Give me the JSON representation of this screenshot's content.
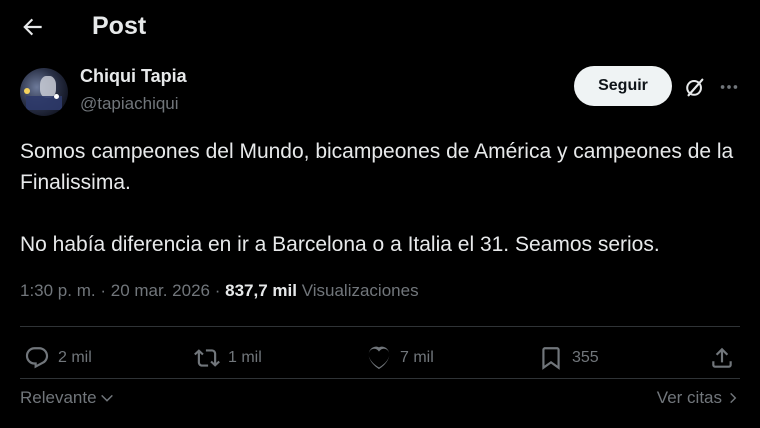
{
  "header": {
    "title": "Post"
  },
  "author": {
    "name": "Chiqui Tapia",
    "handle": "@tapiachiqui"
  },
  "follow_button": {
    "label": "Seguir"
  },
  "tweet": {
    "paragraph1": "Somos campeones del Mundo, bicampeones de América y campeones de la Finalissima.",
    "paragraph2": "No había diferencia en ir a Barcelona o a Italia el 31. Seamos serios."
  },
  "meta": {
    "time": "1:30 p. m.",
    "separator": "·",
    "date": "20 mar. 2026",
    "views_count": "837,7 mil",
    "views_label": "Visualizaciones"
  },
  "actions": {
    "replies": "2 mil",
    "reposts": "1 mil",
    "likes": "7 mil",
    "bookmarks": "355"
  },
  "footer": {
    "sort_label": "Relevante",
    "quotes_label": "Ver citas"
  },
  "icons": {
    "back": "arrow-left-icon",
    "grok": "grok-icon",
    "more": "more-horizontal-icon",
    "reply": "reply-icon",
    "repost": "repost-icon",
    "like": "heart-icon",
    "bookmark": "bookmark-icon",
    "share": "share-icon"
  },
  "colors": {
    "background": "#000000",
    "text": "#e7e9ea",
    "muted": "#71767b",
    "divider": "#2f3336",
    "follow_bg": "#eff3f4"
  }
}
